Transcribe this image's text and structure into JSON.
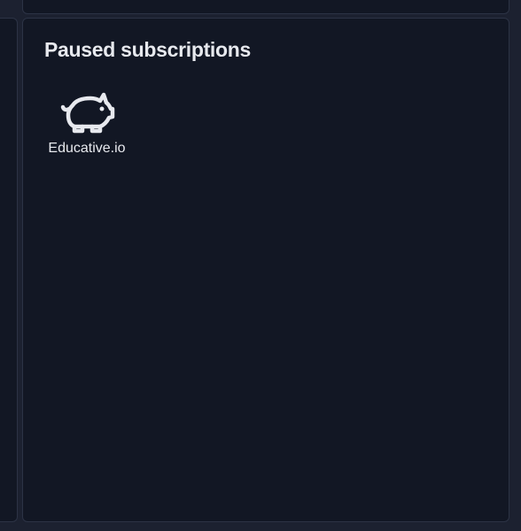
{
  "paused_panel": {
    "title": "Paused subscriptions",
    "items": [
      {
        "label": "Educative.io",
        "icon": "piggy-bank-icon"
      }
    ]
  },
  "colors": {
    "page_background": "#1c2130",
    "panel_background": "#121724",
    "panel_border": "#2c3345",
    "text": "#e7e9ee"
  }
}
